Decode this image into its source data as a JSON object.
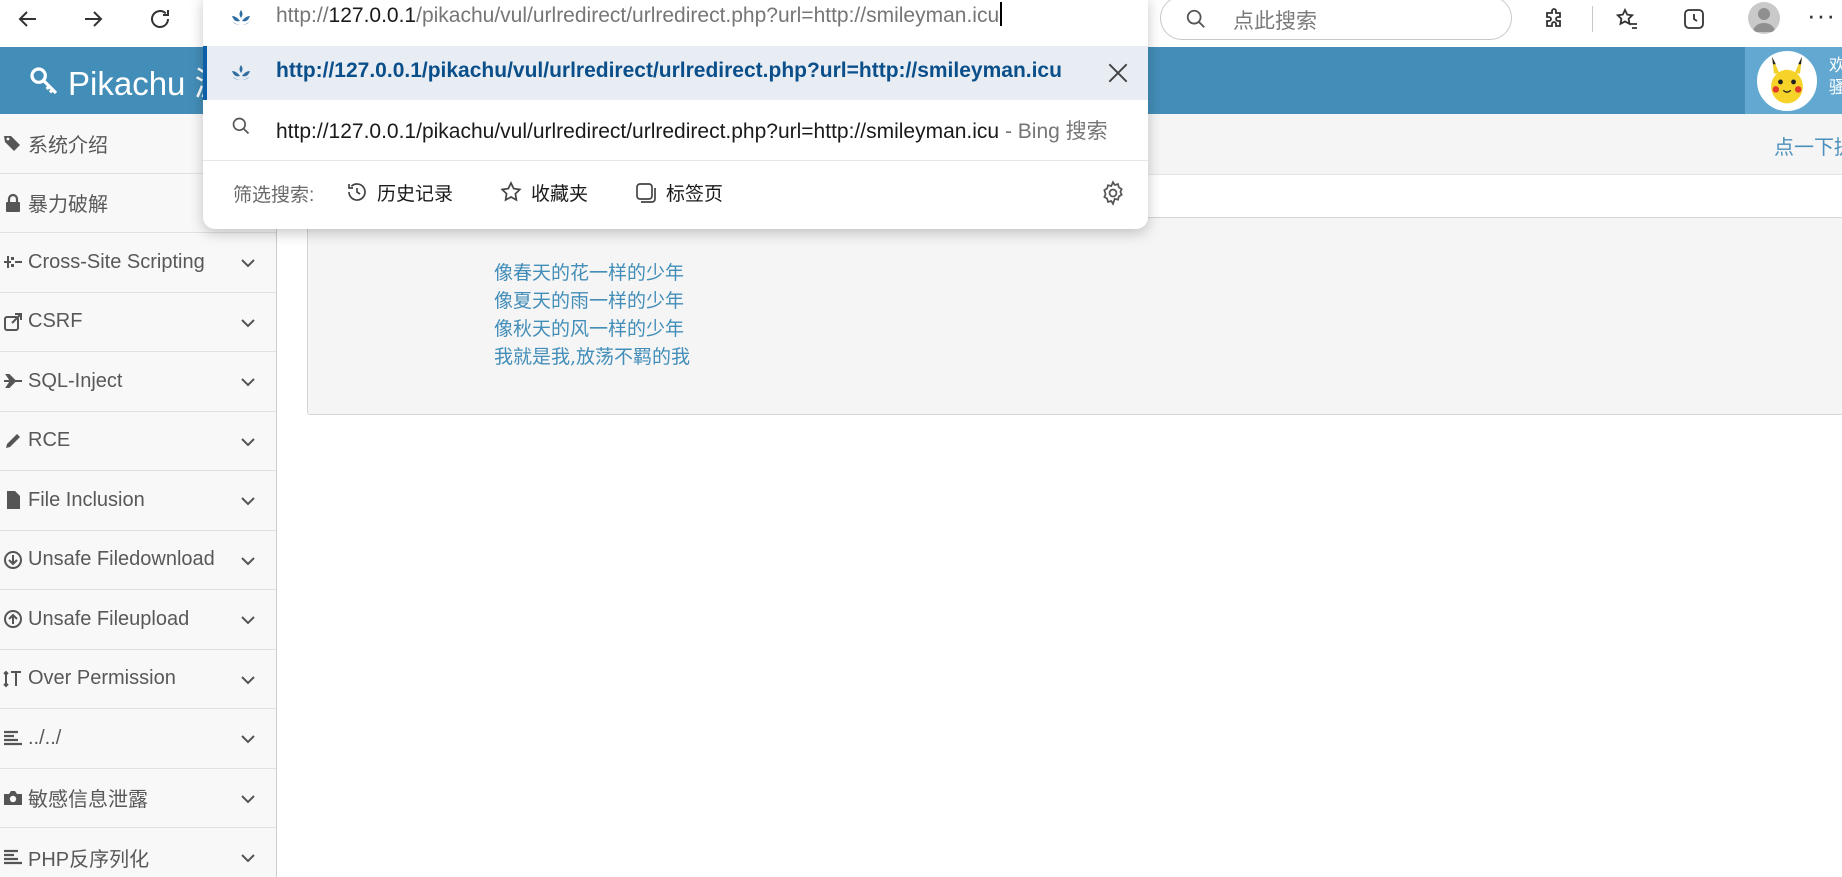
{
  "browser": {
    "address_bar": {
      "url_prefix": "http://",
      "url_host": "127.0.0.1",
      "url_rest": "/pikachu/vul/urlredirect/urlredirect.php?url=http://smileyman.icu"
    },
    "suggestions": [
      {
        "text": "http://127.0.0.1/pikachu/vul/urlredirect/urlredirect.php?url=http://smileyman.icu"
      },
      {
        "text": "http://127.0.0.1/pikachu/vul/urlredirect/urlredirect.php?url=http://smileyman.icu",
        "suffix": " - Bing 搜索"
      }
    ],
    "filter": {
      "label": "筛选搜索:",
      "history": "历史记录",
      "favorites": "收藏夹",
      "tabs": "标签页"
    },
    "search_placeholder": "点此搜索"
  },
  "header": {
    "brand": "Pikachu 漏",
    "user_text_1": "欢",
    "user_text_2": "骚"
  },
  "sidebar": {
    "items": [
      {
        "label": "系统介绍"
      },
      {
        "label": "暴力破解"
      },
      {
        "label": "Cross-Site Scripting"
      },
      {
        "label": "CSRF"
      },
      {
        "label": "SQL-Inject"
      },
      {
        "label": "RCE"
      },
      {
        "label": "File Inclusion"
      },
      {
        "label": "Unsafe Filedownload"
      },
      {
        "label": "Unsafe Fileupload"
      },
      {
        "label": "Over Permission"
      },
      {
        "label": "../../"
      },
      {
        "label": "敏感信息泄露"
      },
      {
        "label": "PHP反序列化"
      }
    ]
  },
  "breadcrumb": {
    "link": "点一下提"
  },
  "content": {
    "lines": [
      "像春天的花一样的少年",
      "像夏天的雨一样的少年",
      "像秋天的风一样的少年",
      "我就是我,放荡不羁的我"
    ]
  },
  "colors": {
    "header_bg": "#438eb9",
    "accent": "#438eb9",
    "sidebar_bg": "#f2f2f2"
  }
}
